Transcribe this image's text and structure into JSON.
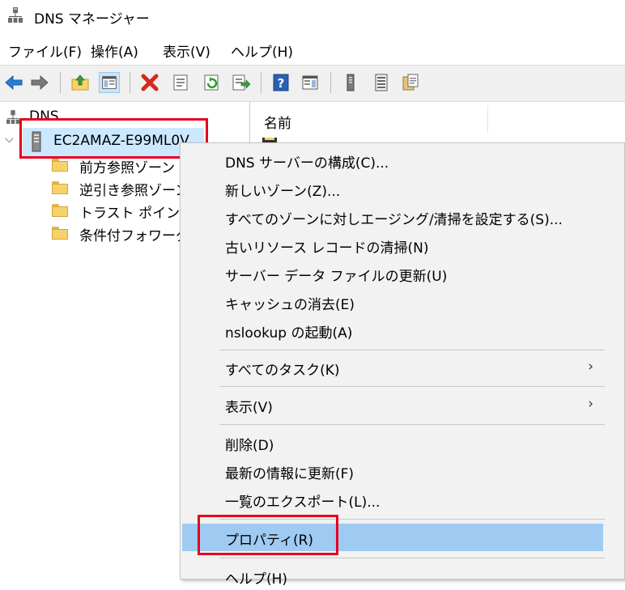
{
  "window": {
    "title": "DNS マネージャー"
  },
  "menubar": {
    "items": [
      {
        "label": "ファイル(F)"
      },
      {
        "label": "操作(A)"
      },
      {
        "label": "表示(V)"
      },
      {
        "label": "ヘルプ(H)"
      }
    ]
  },
  "toolbar": {
    "buttons": [
      {
        "icon": "back-arrow-icon"
      },
      {
        "icon": "forward-arrow-icon"
      },
      {
        "icon": "up-folder-icon"
      },
      {
        "icon": "show-hide-tree-icon"
      },
      {
        "icon": "delete-icon"
      },
      {
        "icon": "properties-icon"
      },
      {
        "icon": "refresh-icon"
      },
      {
        "icon": "export-list-icon"
      },
      {
        "icon": "help-icon"
      },
      {
        "icon": "action-pane-icon"
      },
      {
        "icon": "server-icon"
      },
      {
        "icon": "list-icon"
      },
      {
        "icon": "clipboard-icon"
      }
    ]
  },
  "tree": {
    "root": {
      "label": "DNS"
    },
    "server": {
      "label": "EC2AMAZ-E99ML0V"
    },
    "children": [
      {
        "label": "前方参照ゾーン"
      },
      {
        "label": "逆引き参照ゾーン"
      },
      {
        "label": "トラスト ポイント"
      },
      {
        "label": "条件付フォワーダー"
      }
    ]
  },
  "list": {
    "column_name": "名前"
  },
  "context_menu": {
    "group1": [
      {
        "label": "DNS サーバーの構成(C)..."
      },
      {
        "label": "新しいゾーン(Z)..."
      },
      {
        "label": "すべてのゾーンに対しエージング/清掃を設定する(S)..."
      },
      {
        "label": "古いリソース レコードの清掃(N)"
      },
      {
        "label": "サーバー データ ファイルの更新(U)"
      },
      {
        "label": "キャッシュの消去(E)"
      },
      {
        "label": "nslookup の起動(A)"
      }
    ],
    "all_tasks": {
      "label": "すべてのタスク(K)"
    },
    "view": {
      "label": "表示(V)"
    },
    "group3": [
      {
        "label": "削除(D)"
      },
      {
        "label": "最新の情報に更新(F)"
      },
      {
        "label": "一覧のエクスポート(L)..."
      }
    ],
    "properties": {
      "label": "プロパティ(R)"
    },
    "help": {
      "label": "ヘルプ(H)"
    },
    "submenu_arrow": "›"
  },
  "colors": {
    "highlight": "#9fcaf2",
    "selection": "#cce8ff",
    "annotation_red": "#e8001b"
  }
}
